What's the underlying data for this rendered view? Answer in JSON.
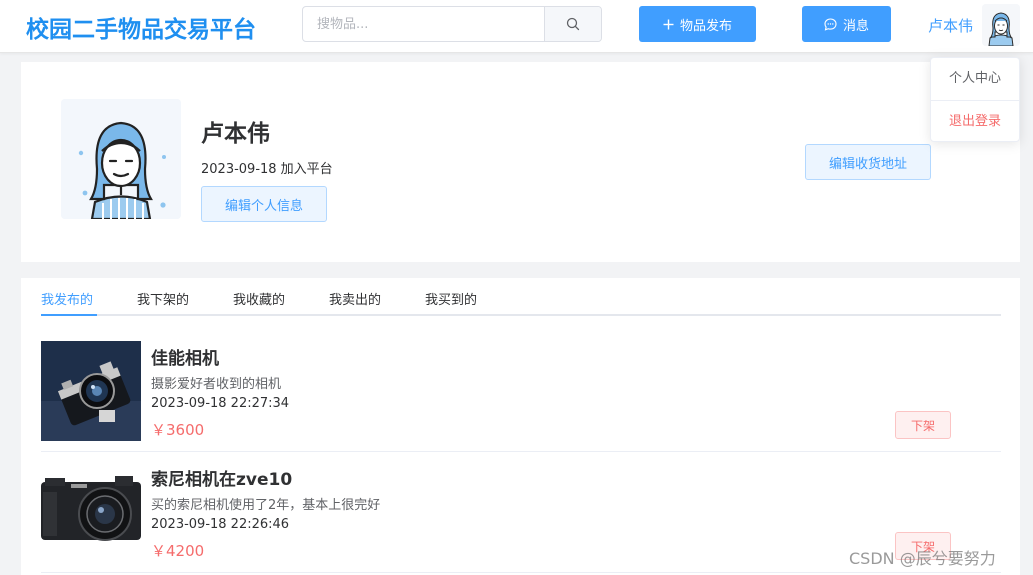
{
  "header": {
    "logo": "校园二手物品交易平台",
    "search_placeholder": "搜物品...",
    "publish_label": "物品发布",
    "message_label": "消息",
    "nickname": "卢本伟"
  },
  "user_menu": {
    "items": [
      "个人中心",
      "退出登录"
    ]
  },
  "profile": {
    "name": "卢本伟",
    "join_text": "2023-09-18 加入平台",
    "edit_info_label": "编辑个人信息",
    "edit_address_label": "编辑收货地址"
  },
  "tabs": {
    "items": [
      "我发布的",
      "我下架的",
      "我收藏的",
      "我卖出的",
      "我买到的"
    ],
    "active": "我发布的"
  },
  "goods": [
    {
      "title": "佳能相机",
      "desc": "摄影爱好者收到的相机",
      "time": "2023-09-18 22:27:34",
      "price": "￥3600",
      "action": "下架"
    },
    {
      "title": "索尼相机在zve10",
      "desc": "买的索尼相机使用了2年，基本上很完好",
      "time": "2023-09-18 22:26:46",
      "price": "￥4200",
      "action": "下架"
    }
  ],
  "watermark": "CSDN @辰兮要努力",
  "colors": {
    "primary": "#409eff",
    "logo": "#1f8ff0",
    "danger": "#f56c6c",
    "page_bg": "#f2f3f5"
  }
}
